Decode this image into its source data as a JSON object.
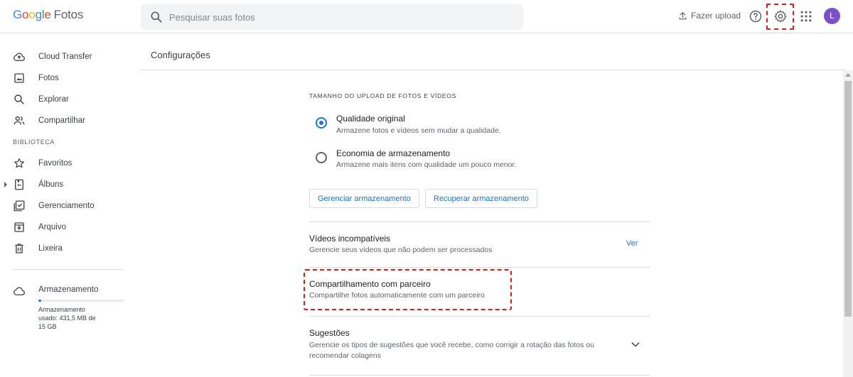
{
  "header": {
    "logo_google": [
      "G",
      "o",
      "o",
      "g",
      "l",
      "e"
    ],
    "logo_product": "Fotos",
    "search_placeholder": "Pesquisar suas fotos",
    "upload_label": "Fazer upload",
    "avatar_letter": "L"
  },
  "sidebar": {
    "items": [
      {
        "label": "Cloud Transfer",
        "icon": "cloud-upload-icon"
      },
      {
        "label": "Fotos",
        "icon": "photo-icon"
      },
      {
        "label": "Explorar",
        "icon": "search-icon"
      },
      {
        "label": "Compartilhar",
        "icon": "people-icon"
      }
    ],
    "library_label": "BIBLIOTECA",
    "library_items": [
      {
        "label": "Favoritos",
        "icon": "star-icon"
      },
      {
        "label": "Álbuns",
        "icon": "album-icon"
      },
      {
        "label": "Gerenciamento",
        "icon": "checklist-icon"
      },
      {
        "label": "Arquivo",
        "icon": "archive-icon"
      },
      {
        "label": "Lixeira",
        "icon": "trash-icon"
      }
    ],
    "storage": {
      "title": "Armazenamento",
      "usage_text": "Armazenamento usado: 431,5 MB de 15 GB",
      "used_fraction": 0.03
    }
  },
  "main": {
    "page_title": "Configurações",
    "upload_section": {
      "heading": "TAMANHO DO UPLOAD DE FOTOS E VÍDEOS",
      "options": [
        {
          "title": "Qualidade original",
          "subtitle": "Armazene fotos e vídeos sem mudar a qualidade.",
          "selected": true
        },
        {
          "title": "Economia de armazenamento",
          "subtitle": "Armazene mais itens com qualidade um pouco menor.",
          "selected": false
        }
      ],
      "buttons": [
        "Gerenciar armazenamento",
        "Recuperar armazenamento"
      ]
    },
    "rows": [
      {
        "title": "Vídeos incompatíveis",
        "subtitle": "Gerencie seus vídeos que não podem ser processados",
        "action": "Ver"
      },
      {
        "title": "Compartilhamento com parceiro",
        "subtitle": "Compartilhe fotos automaticamente com um parceiro"
      },
      {
        "title": "Sugestões",
        "subtitle": "Gerencie os tipos de sugestões que você recebe, como corrigir a rotação das fotos ou recomendar colagens"
      }
    ]
  },
  "colors": {
    "accent": "#1a73e8",
    "highlight": "#e01b1b",
    "avatar": "#7b4fc9"
  }
}
